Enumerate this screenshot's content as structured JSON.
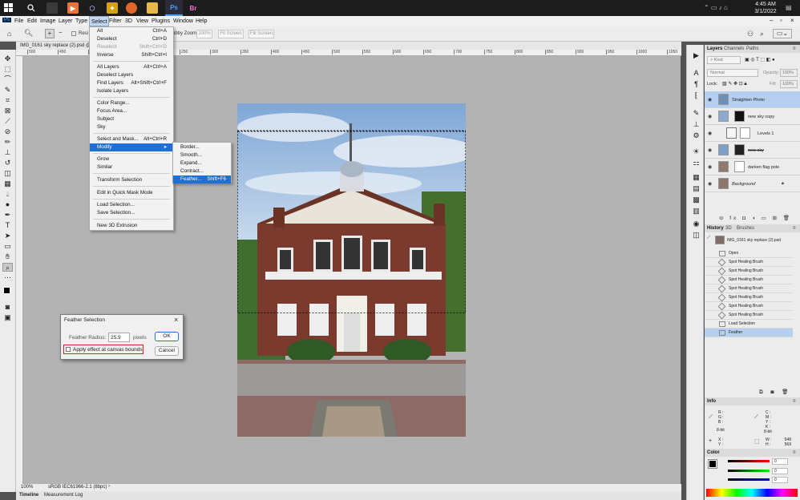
{
  "taskbar": {
    "app_ps": "Ps",
    "app_br": "Br",
    "time": "4:45 AM",
    "date": "3/1/2022"
  },
  "menubar": {
    "ps_logo": "Ps",
    "items": [
      "File",
      "Edit",
      "Image",
      "Layer",
      "Type",
      "Select",
      "Filter",
      "3D",
      "View",
      "Plugins",
      "Window",
      "Help"
    ]
  },
  "options_bar": {
    "resize_label": "Resi",
    "scrubby_zoom": "ubby Zoom",
    "zoom_value": "100%",
    "fit_screen": "Fit Screen",
    "fill_screen": "Fill Screen"
  },
  "document": {
    "tab_title": "IMG_0161 sky replace (2).psd @ 100%",
    "ruler_ticks": [
      "500",
      "450",
      "400",
      "150",
      "200",
      "250",
      "300",
      "350",
      "400",
      "450",
      "500",
      "550",
      "600",
      "650",
      "700",
      "750",
      "800",
      "850",
      "900",
      "950",
      "1000",
      "1050"
    ]
  },
  "select_menu": {
    "items": [
      {
        "label": "All",
        "shortcut": "Ctrl+A"
      },
      {
        "label": "Deselect",
        "shortcut": "Ctrl+D"
      },
      {
        "label": "Reselect",
        "shortcut": "Shift+Ctrl+D"
      },
      {
        "label": "Inverse",
        "shortcut": "Shift+Ctrl+I"
      },
      {
        "label": "All Layers",
        "shortcut": "Alt+Ctrl+A"
      },
      {
        "label": "Deselect Layers",
        "shortcut": ""
      },
      {
        "label": "Find Layers",
        "shortcut": "Alt+Shift+Ctrl+F"
      },
      {
        "label": "Isolate Layers",
        "shortcut": ""
      },
      {
        "label": "Color Range...",
        "shortcut": ""
      },
      {
        "label": "Focus Area...",
        "shortcut": ""
      },
      {
        "label": "Subject",
        "shortcut": ""
      },
      {
        "label": "Sky",
        "shortcut": ""
      },
      {
        "label": "Select and Mask...",
        "shortcut": "Alt+Ctrl+R"
      },
      {
        "label": "Modify",
        "shortcut": ""
      },
      {
        "label": "Grow",
        "shortcut": ""
      },
      {
        "label": "Similar",
        "shortcut": ""
      },
      {
        "label": "Transform Selection",
        "shortcut": ""
      },
      {
        "label": "Edit in Quick Mask Mode",
        "shortcut": ""
      },
      {
        "label": "Load Selection...",
        "shortcut": ""
      },
      {
        "label": "Save Selection...",
        "shortcut": ""
      },
      {
        "label": "New 3D Extrusion",
        "shortcut": ""
      }
    ]
  },
  "modify_submenu": {
    "items": [
      {
        "label": "Border...",
        "shortcut": ""
      },
      {
        "label": "Smooth...",
        "shortcut": ""
      },
      {
        "label": "Expand...",
        "shortcut": ""
      },
      {
        "label": "Contract...",
        "shortcut": ""
      },
      {
        "label": "Feather...",
        "shortcut": "Shift+F6"
      }
    ]
  },
  "feather_dialog": {
    "title": "Feather Selection",
    "radius_label": "Feather Radius:",
    "radius_value": "25.9",
    "unit": "pixels",
    "checkbox_label": "Apply effect at canvas bounds",
    "ok": "OK",
    "cancel": "Cancel"
  },
  "layers_panel": {
    "tabs": [
      "Layers",
      "Channels",
      "Paths"
    ],
    "kind": "Kind",
    "blend_mode": "Normal",
    "opacity_label": "Opacity:",
    "opacity_value": "100%",
    "lock_label": "Lock:",
    "fill_label": "Fill:",
    "fill_value": "100%",
    "layers": [
      "Straighten Photo",
      "new sky copy",
      "Levels 1",
      "new sky",
      "darken flag pole",
      "Background"
    ]
  },
  "history_panel": {
    "tabs": [
      "History",
      "3D",
      "Brushes"
    ],
    "snapshot": "IMG_0161 sky replace (2).psd",
    "items": [
      "Open",
      "Spot Healing Brush",
      "Spot Healing Brush",
      "Spot Healing Brush",
      "Spot Healing Brush",
      "Spot Healing Brush",
      "Spot Healing Brush",
      "Spot Healing Brush",
      "Load Selection",
      "Feather"
    ]
  },
  "info_panel": {
    "title": "Info",
    "rgb": [
      "R :",
      "G :",
      "B :"
    ],
    "cmyk": [
      "C :",
      "M :",
      "Y :",
      "K :"
    ],
    "bit_left": "8-bit",
    "bit_right": "8-bit",
    "xy": [
      "X :",
      "Y :"
    ],
    "wh_labels": [
      "W :",
      "H :"
    ],
    "w_value": "548",
    "h_value": "569"
  },
  "color_panel": {
    "title": "Color",
    "values": [
      "0",
      "0",
      "0"
    ]
  },
  "status_bar": {
    "zoom": "100%",
    "profile": "sRGB IEC61966-2.1 (8bpc)"
  },
  "bottom_tabs": [
    "Timeline",
    "Measurement Log"
  ],
  "colors": {
    "accent": "#1e6fd6",
    "highlight_row": "#b4cff0",
    "checkbox_outline": "#d92020"
  }
}
